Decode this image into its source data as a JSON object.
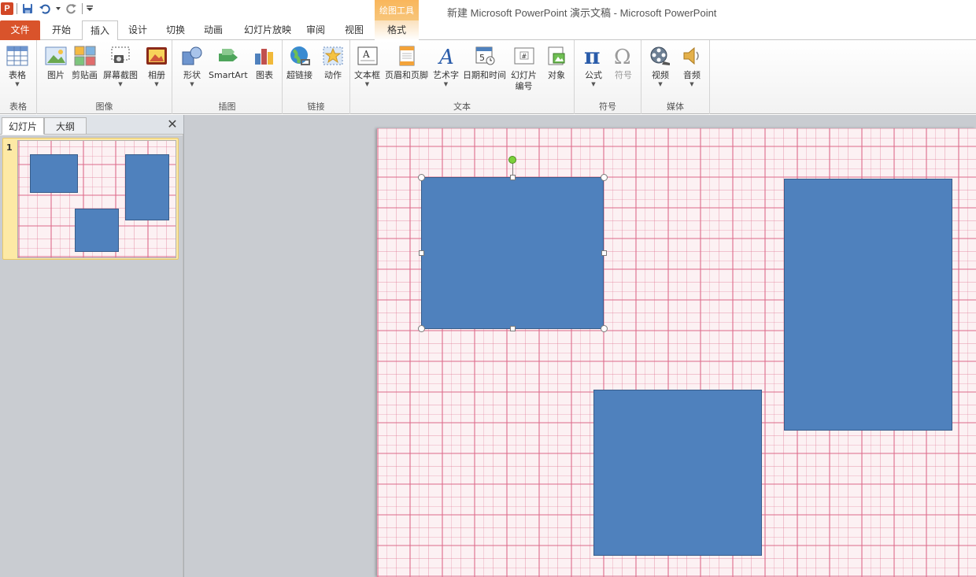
{
  "window": {
    "title": "新建 Microsoft PowerPoint 演示文稿  -  Microsoft PowerPoint",
    "app_logo": "P",
    "quick_access": [
      "save-icon",
      "undo-icon",
      "redo-icon",
      "customize-icon"
    ]
  },
  "contextual": {
    "group_label": "绘图工具"
  },
  "tabs": {
    "file": "文件",
    "home": "开始",
    "insert": "插入",
    "design": "设计",
    "transitions": "切换",
    "animations": "动画",
    "slideshow": "幻灯片放映",
    "review": "审阅",
    "view": "视图",
    "format": "格式"
  },
  "ribbon": {
    "groups": {
      "tables": "表格",
      "images": "图像",
      "illustrations": "插图",
      "links": "链接",
      "text": "文本",
      "symbols": "符号",
      "media": "媒体"
    },
    "buttons": {
      "table": "表格",
      "picture": "图片",
      "clipart": "剪贴画",
      "screenshot": "屏幕截图",
      "album": "相册",
      "shapes": "形状",
      "smartart": "SmartArt",
      "chart": "图表",
      "hyperlink": "超链接",
      "action": "动作",
      "textbox": "文本框",
      "header_footer": "页眉和页脚",
      "wordart": "艺术字",
      "datetime": "日期和时间",
      "slide_number_line1": "幻灯片",
      "slide_number_line2": "编号",
      "object": "对象",
      "equation": "公式",
      "symbol": "符号",
      "video": "视频",
      "audio": "音频"
    }
  },
  "pane": {
    "tab_slides": "幻灯片",
    "tab_outline": "大纲",
    "close_glyph": "✕",
    "slide_number": "1"
  },
  "colors": {
    "shape_fill": "#4f81bd",
    "shape_border": "#385d8a",
    "file_tab": "#d9532b",
    "context_tab": "#f9b65b"
  }
}
